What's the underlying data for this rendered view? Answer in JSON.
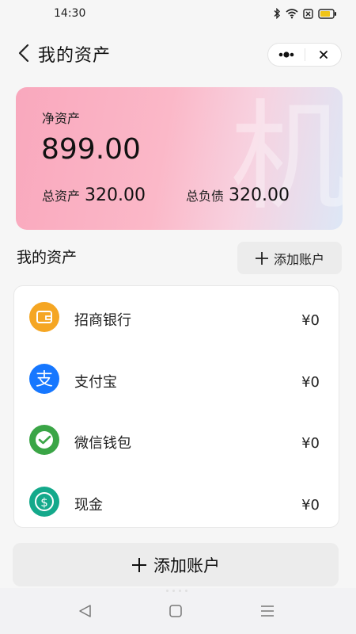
{
  "status_bar": {
    "time": "14:30"
  },
  "header": {
    "title": "我的资产"
  },
  "net_card": {
    "net_label": "净资产",
    "net_value": "899.00",
    "total_assets_label": "总资产",
    "total_assets_value": "320.00",
    "total_debts_label": "总负债",
    "total_debts_value": "320.00",
    "watermark": "机"
  },
  "assets_section": {
    "title": "我的资产",
    "add_button_label": "添加账户"
  },
  "accounts": [
    {
      "name": "招商银行",
      "amount": "¥0",
      "icon": "wallet-icon",
      "color": "#f5a623"
    },
    {
      "name": "支付宝",
      "amount": "¥0",
      "icon": "alipay-icon",
      "color": "#1677ff"
    },
    {
      "name": "微信钱包",
      "amount": "¥0",
      "icon": "wechat-pay-icon",
      "color": "#3aa546"
    },
    {
      "name": "现金",
      "amount": "¥0",
      "icon": "cash-icon",
      "color": "#14a98b"
    }
  ],
  "bottom_add_button": {
    "label": "添加账户"
  }
}
